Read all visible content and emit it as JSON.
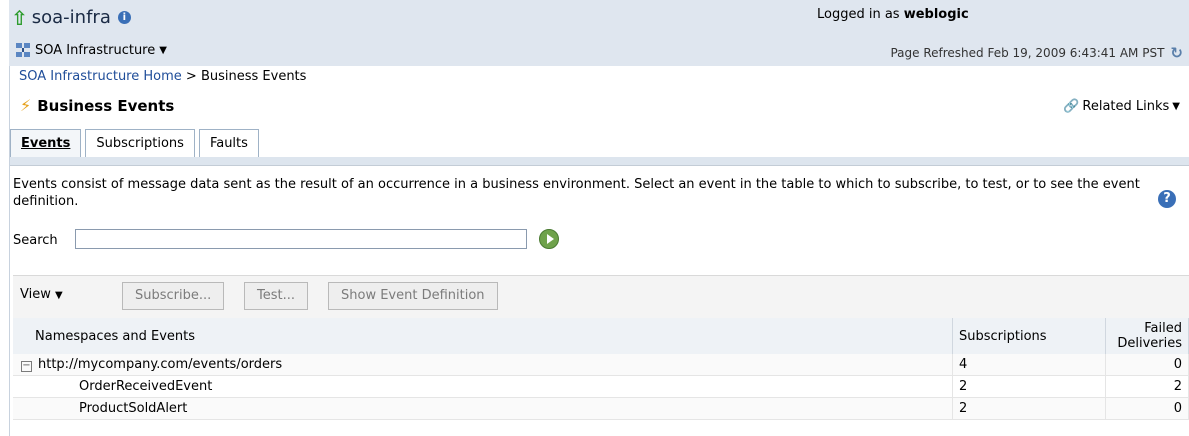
{
  "header": {
    "app_title": "soa-infra",
    "infra_menu": "SOA Infrastructure",
    "logged_in_prefix": "Logged in as",
    "user": "weblogic",
    "refreshed": "Page Refreshed Feb 19, 2009 6:43:41 AM PST"
  },
  "breadcrumb": {
    "home": "SOA Infrastructure Home",
    "separator": ">",
    "current": "Business Events"
  },
  "page": {
    "title": "Business Events",
    "related_links": "Related Links"
  },
  "tabs": [
    {
      "label": "Events",
      "active": true
    },
    {
      "label": "Subscriptions",
      "active": false
    },
    {
      "label": "Faults",
      "active": false
    }
  ],
  "description": "Events consist of message data sent as the result of an occurrence in a business environment. Select an event in the table to which to subscribe, to test, or to see the event definition.",
  "search": {
    "label": "Search",
    "value": ""
  },
  "toolbar": {
    "view": "View",
    "subscribe": "Subscribe...",
    "test": "Test...",
    "show_def": "Show Event Definition"
  },
  "table": {
    "headers": {
      "name": "Namespaces and Events",
      "subscriptions": "Subscriptions",
      "failed_line1": "Failed",
      "failed_line2": "Deliveries"
    },
    "rows": [
      {
        "name": "http://mycompany.com/events/orders",
        "subscriptions": "4",
        "failed": "0"
      },
      {
        "name": "OrderReceivedEvent",
        "subscriptions": "2",
        "failed": "2"
      },
      {
        "name": "ProductSoldAlert",
        "subscriptions": "2",
        "failed": "0"
      }
    ]
  }
}
